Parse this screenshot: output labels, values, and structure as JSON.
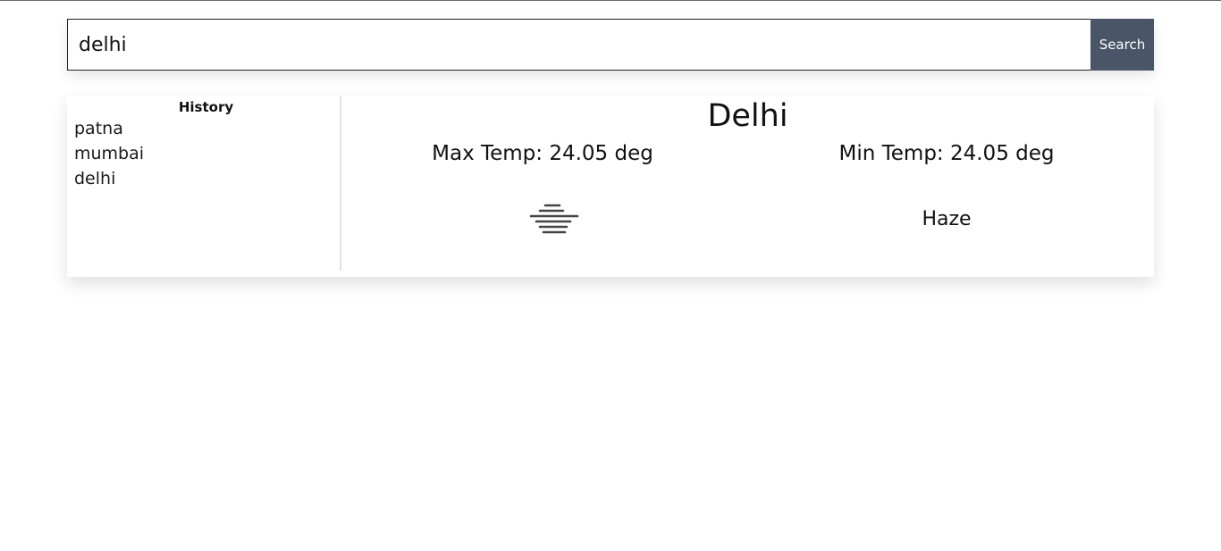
{
  "search": {
    "value": "delhi",
    "button_label": "Search"
  },
  "history": {
    "title": "History",
    "items": [
      "patna",
      "mumbai",
      "delhi"
    ]
  },
  "weather": {
    "city": "Delhi",
    "max_temp": "Max Temp: 24.05 deg",
    "min_temp": "Min Temp: 24.05 deg",
    "condition": "Haze",
    "condition_icon": "haze-icon"
  },
  "colors": {
    "button_bg": "#4a5568",
    "icon": "#444444"
  }
}
